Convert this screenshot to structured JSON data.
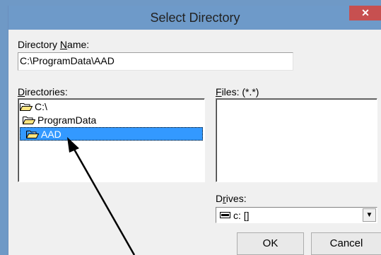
{
  "window": {
    "title": "Select Directory",
    "close_glyph": "✕"
  },
  "directory_name": {
    "label_pre": "Directory ",
    "label_u": "N",
    "label_post": "ame:",
    "value": "C:\\ProgramData\\AAD"
  },
  "directories": {
    "label_u": "D",
    "label_post": "irectories:",
    "items": [
      {
        "label": "C:\\",
        "icon": "open-folder-icon"
      },
      {
        "label": "ProgramData",
        "icon": "open-folder-icon"
      },
      {
        "label": "AAD",
        "icon": "open-folder-icon",
        "selected": true
      }
    ]
  },
  "files": {
    "label_u": "F",
    "label_post": "iles: (*.*)"
  },
  "drives": {
    "label_pre": "D",
    "label_u": "r",
    "label_post": "ives:",
    "selected": "c: []",
    "icon": "drive-icon"
  },
  "buttons": {
    "ok": "OK",
    "cancel": "Cancel"
  },
  "colors": {
    "titlebar": "#6e9ac9",
    "selection": "#3399ff",
    "close": "#c75050"
  }
}
